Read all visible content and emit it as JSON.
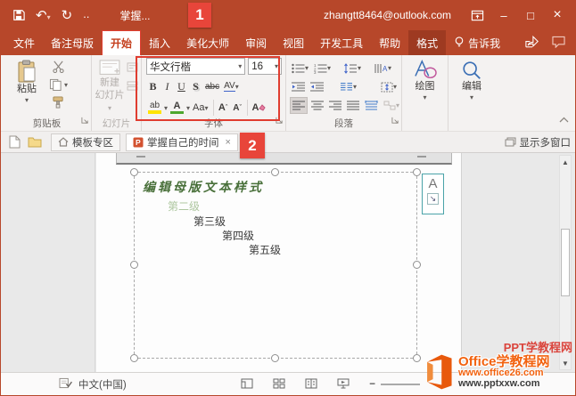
{
  "colors": {
    "brand": "#b7472a",
    "annotation": "#e03d30",
    "badge": "#e8453a",
    "autofit_teal": "#4aa3a8",
    "watermark_orange": "#f2620f",
    "font_color_bar": "#4ea72e",
    "highlight_bar": "#ffe400"
  },
  "title_bar": {
    "badge": "1",
    "doc_title": "掌握...",
    "account": "zhangtt8464@outlook.com",
    "minimize": "–",
    "maximize": "□",
    "close": "×"
  },
  "tabs": {
    "file": "文件",
    "notes_master": "备注母版",
    "home": "开始",
    "insert": "插入",
    "beautify": "美化大师",
    "review": "审阅",
    "view": "视图",
    "developer": "开发工具",
    "help": "帮助",
    "format": "格式",
    "tell_me": "告诉我"
  },
  "ribbon": {
    "clipboard": {
      "label": "剪贴板",
      "paste": "粘贴"
    },
    "slides": {
      "label": "幻灯片",
      "new_slide_line1": "新建",
      "new_slide_line2": "幻灯片"
    },
    "font": {
      "label": "字体",
      "badge": "2",
      "name": "华文行楷",
      "size": "16",
      "bold": "B",
      "italic": "I",
      "underline": "U",
      "shadow": "S",
      "strike": "abc",
      "spacing": "AV",
      "case": "Aa",
      "grow": "A",
      "shrink": "A",
      "highlight": "ab",
      "color": "A",
      "clear": "A"
    },
    "paragraph": {
      "label": "段落"
    },
    "draw": {
      "label": "绘图"
    },
    "edit": {
      "label": "编辑"
    }
  },
  "doc_tabs": {
    "template_tab": "模板专区",
    "active_tab": "掌握自己的时间",
    "close": "×",
    "new_tab": "+",
    "show_windows": "显示多窗口"
  },
  "slide": {
    "line1": "编辑母版文本样式",
    "line2": "第二级",
    "line3": "第三级",
    "line4": "第四级",
    "line5": "第五级",
    "autofit_letter": "A",
    "autofit_arrow": "↘"
  },
  "status": {
    "language": "中文(中国)"
  },
  "watermark": {
    "name": "Office学教程网",
    "alt_name": "PPT学教程网",
    "url1": "www.office26.com",
    "url2": "www.pptxxw.com"
  }
}
